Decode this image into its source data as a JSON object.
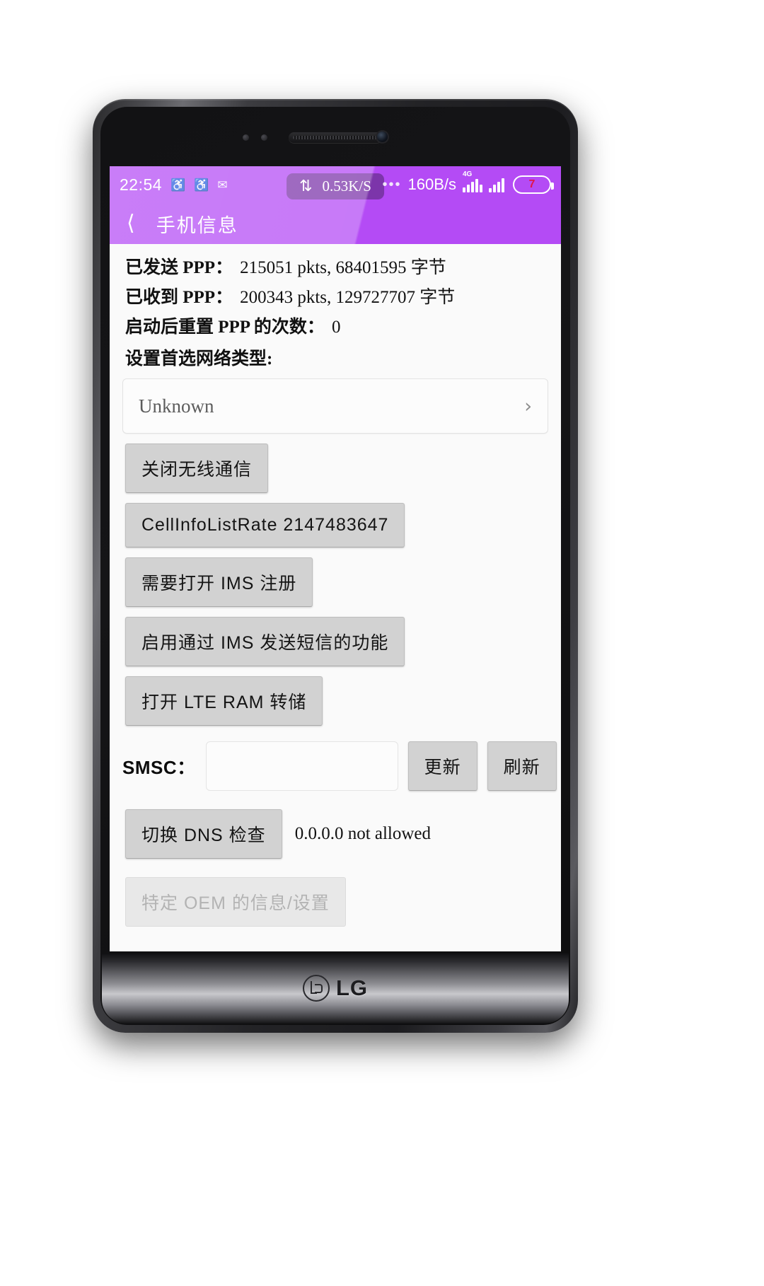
{
  "device": {
    "brand": "LG"
  },
  "status_bar": {
    "clock": "22:54",
    "icons": [
      "bell-icon",
      "bell-icon",
      "message-icon"
    ],
    "net_speed_pill": {
      "icon": "sync-icon",
      "value": "0.53K/S"
    },
    "overflow": "•••",
    "data_rate": "160B/s",
    "network_label": "4G",
    "battery_level": "7",
    "accent_color": "#b44bf5"
  },
  "app_bar": {
    "back_icon": "chevron-left-icon",
    "title": "手机信息"
  },
  "info_lines": [
    {
      "label": "已发送 PPP：",
      "value": "215051 pkts, 68401595 字节"
    },
    {
      "label": "已收到 PPP：",
      "value": "200343 pkts, 129727707 字节"
    },
    {
      "label": "启动后重置 PPP 的次数：",
      "value": "0"
    }
  ],
  "network_type": {
    "section_label": "设置首选网络类型:",
    "selected": "Unknown",
    "chevron_icon": "chevron-right-icon"
  },
  "buttons": [
    {
      "label": "关闭无线通信",
      "enabled": true
    },
    {
      "label": "CellInfoListRate 2147483647",
      "enabled": true
    },
    {
      "label": "需要打开 IMS 注册",
      "enabled": true
    },
    {
      "label": "启用通过 IMS 发送短信的功能",
      "enabled": true
    },
    {
      "label": "打开 LTE RAM 转储",
      "enabled": true
    }
  ],
  "smsc": {
    "label": "SMSC：",
    "value": "",
    "placeholder": "",
    "update_button": "更新",
    "refresh_button": "刷新"
  },
  "dns": {
    "toggle_button": "切换 DNS 检查",
    "status": "0.0.0.0 not allowed"
  },
  "oem": {
    "button_label": "特定 OEM 的信息/设置",
    "enabled": false
  }
}
